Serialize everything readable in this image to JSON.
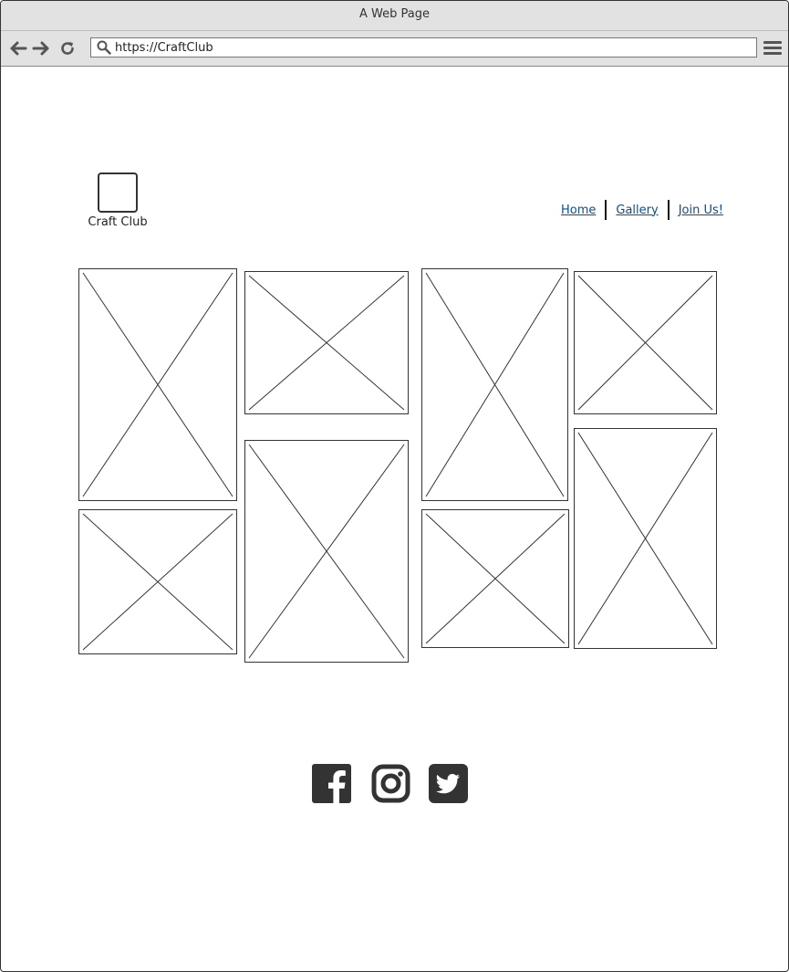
{
  "window": {
    "title": "A Web Page"
  },
  "browser": {
    "url": "https://CraftClub"
  },
  "brand": {
    "name": "Craft Club"
  },
  "nav": {
    "items": [
      "Home",
      "Gallery",
      "Join Us!"
    ]
  },
  "gallery": {
    "image_count": 8
  },
  "social": {
    "icons": [
      "facebook-icon",
      "instagram-icon",
      "twitter-icon"
    ]
  },
  "colors": {
    "link": "#0a4f8f",
    "chrome": "#e2e2e2",
    "icon": "#333333"
  }
}
